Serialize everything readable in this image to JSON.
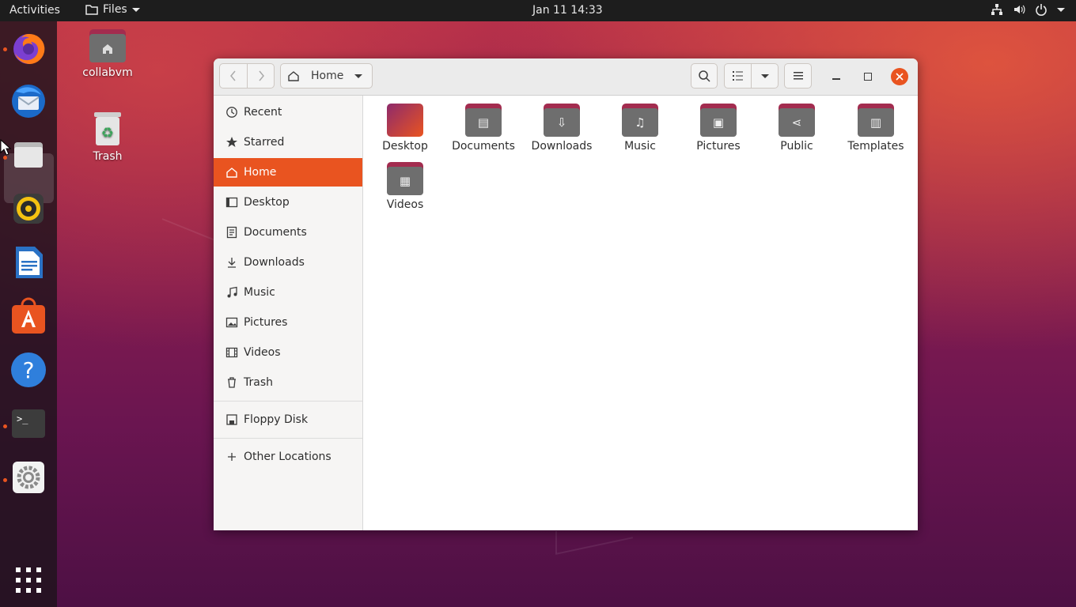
{
  "topbar": {
    "activities": "Activities",
    "app_menu": "Files",
    "clock": "Jan 11  14:33"
  },
  "desktop_icons": [
    {
      "label": "collabvm"
    },
    {
      "label": "Trash"
    }
  ],
  "window": {
    "location": "Home",
    "sidebar": {
      "items": [
        {
          "label": "Recent",
          "icon": "clock-icon"
        },
        {
          "label": "Starred",
          "icon": "star-icon"
        },
        {
          "label": "Home",
          "icon": "home-icon",
          "active": true
        },
        {
          "label": "Desktop",
          "icon": "desktop-icon"
        },
        {
          "label": "Documents",
          "icon": "document-icon"
        },
        {
          "label": "Downloads",
          "icon": "download-icon"
        },
        {
          "label": "Music",
          "icon": "music-icon"
        },
        {
          "label": "Pictures",
          "icon": "picture-icon"
        },
        {
          "label": "Videos",
          "icon": "video-icon"
        },
        {
          "label": "Trash",
          "icon": "trash-icon"
        }
      ],
      "devices": [
        {
          "label": "Floppy Disk",
          "icon": "floppy-icon"
        }
      ],
      "other": {
        "label": "Other Locations",
        "icon": "plus-icon"
      }
    },
    "folders": [
      {
        "label": "Desktop"
      },
      {
        "label": "Documents"
      },
      {
        "label": "Downloads"
      },
      {
        "label": "Music"
      },
      {
        "label": "Pictures"
      },
      {
        "label": "Public"
      },
      {
        "label": "Templates"
      },
      {
        "label": "Videos"
      }
    ]
  },
  "colors": {
    "accent": "#e95420",
    "folder": "#6e6e6e",
    "folder_tab": "#a32c4f"
  }
}
